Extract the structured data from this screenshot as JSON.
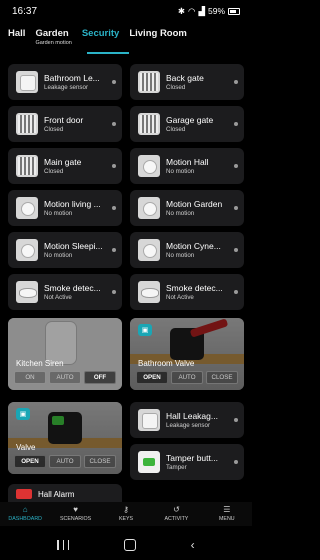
{
  "status": {
    "time": "16:37",
    "battery": "59%"
  },
  "tabs": [
    {
      "label": "Hall",
      "sub": ""
    },
    {
      "label": "Garden",
      "sub": "Garden motion"
    },
    {
      "label": "Security",
      "sub": ""
    },
    {
      "label": "Living Room",
      "sub": ""
    }
  ],
  "active_tab": "Security",
  "cards": [
    {
      "title": "Bathroom Le...",
      "state": "Leakage sensor",
      "icon": "leak-sensor-icon"
    },
    {
      "title": "Back gate",
      "state": "Closed",
      "icon": "gate-icon"
    },
    {
      "title": "Front door",
      "state": "Closed",
      "icon": "door-icon"
    },
    {
      "title": "Garage gate",
      "state": "Closed",
      "icon": "gate-icon"
    },
    {
      "title": "Main gate",
      "state": "Closed",
      "icon": "gate-icon"
    },
    {
      "title": "Motion Hall",
      "state": "No motion",
      "icon": "motion-sensor-icon"
    },
    {
      "title": "Motion living ...",
      "state": "No motion",
      "icon": "motion-sensor-icon"
    },
    {
      "title": "Motion Garden",
      "state": "No motion",
      "icon": "motion-sensor-icon"
    },
    {
      "title": "Motion Sleepi...",
      "state": "No motion",
      "icon": "motion-sensor-icon"
    },
    {
      "title": "Motion Cyne...",
      "state": "No motion",
      "icon": "motion-sensor-icon"
    },
    {
      "title": "Smoke detec...",
      "state": "Not Active",
      "icon": "smoke-detector-icon"
    },
    {
      "title": "Smoke detec...",
      "state": "Not Active",
      "icon": "smoke-detector-icon"
    }
  ],
  "kitchen_siren": {
    "title": "Kitchen Siren",
    "buttons": [
      "ON",
      "AUTO",
      "OFF"
    ],
    "selected": "OFF"
  },
  "bathroom_valve": {
    "title": "Bathroom Valve",
    "buttons": [
      "OPEN",
      "AUTO",
      "CLOSE"
    ],
    "selected": "OPEN"
  },
  "valve": {
    "title": "Valve",
    "buttons": [
      "OPEN",
      "AUTO",
      "CLOSE"
    ],
    "selected": "OPEN"
  },
  "right_cards": [
    {
      "title": "Hall  Leakag...",
      "state": "Leakage sensor",
      "icon": "leak-sensor-icon"
    },
    {
      "title": "Tamper butt...",
      "state": "Tamper",
      "icon": "tamper-button-icon"
    }
  ],
  "hall_alarm": {
    "title": "Hall Alarm"
  },
  "nav": [
    {
      "label": "DASHBOARD",
      "icon": "home-icon",
      "glyph": "⌂"
    },
    {
      "label": "SCENARIOS",
      "icon": "heart-icon",
      "glyph": "♥"
    },
    {
      "label": "KEYS",
      "icon": "key-icon",
      "glyph": "⚷"
    },
    {
      "label": "ACTIVITY",
      "icon": "history-icon",
      "glyph": "↺"
    },
    {
      "label": "MENU",
      "icon": "menu-icon",
      "glyph": "☰"
    }
  ],
  "accent": "#2bb3c7"
}
